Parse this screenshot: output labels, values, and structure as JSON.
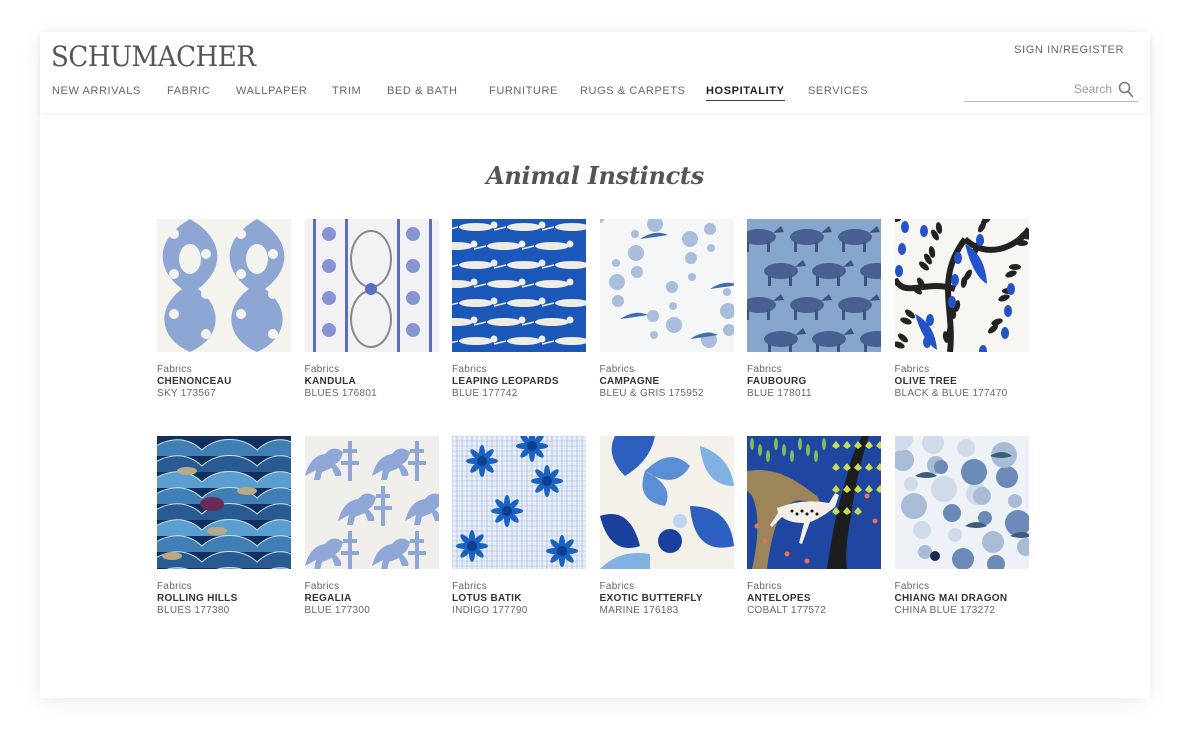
{
  "brand": {
    "logo": "SCHUMACHER"
  },
  "header": {
    "sign_in": "SIGN IN/REGISTER",
    "nav": [
      {
        "label": "NEW ARRIVALS",
        "active": false
      },
      {
        "label": "FABRIC",
        "active": false
      },
      {
        "label": "WALLPAPER",
        "active": false
      },
      {
        "label": "TRIM",
        "active": false
      },
      {
        "label": "BED & BATH",
        "active": false
      },
      {
        "label": "FURNITURE",
        "active": false
      },
      {
        "label": "RUGS & CARPETS",
        "active": false
      },
      {
        "label": "HOSPITALITY",
        "active": true
      },
      {
        "label": "SERVICES",
        "active": false
      }
    ],
    "search": {
      "placeholder": "Search",
      "value": "",
      "icon": "search-icon"
    }
  },
  "collection": {
    "title": "Animal Instincts",
    "products": [
      {
        "category": "Fabrics",
        "name": "CHENONCEAU",
        "colorway": "SKY 173567",
        "swatch": {
          "style": "damask",
          "bg": "#f5f3ee",
          "fg": "#8ea6d4"
        }
      },
      {
        "category": "Fabrics",
        "name": "KANDULA",
        "colorway": "BLUES 176801",
        "swatch": {
          "style": "stripe-toile",
          "bg": "#f2f2f4",
          "fg": "#5a6fc4"
        }
      },
      {
        "category": "Fabrics",
        "name": "LEAPING LEOPARDS",
        "colorway": "BLUE 177742",
        "swatch": {
          "style": "leopards",
          "bg": "#1a57b8",
          "fg": "#efece6"
        }
      },
      {
        "category": "Fabrics",
        "name": "CAMPAGNE",
        "colorway": "BLEU & GRIS 175952",
        "swatch": {
          "style": "floral-birds",
          "bg": "#f4f6f8",
          "fg": "#6b8fc2"
        }
      },
      {
        "category": "Fabrics",
        "name": "FAUBOURG",
        "colorway": "BLUE 178011",
        "swatch": {
          "style": "horses",
          "bg": "#87a6cc",
          "fg": "#3e5286"
        }
      },
      {
        "category": "Fabrics",
        "name": "OLIVE TREE",
        "colorway": "BLACK & BLUE 177470",
        "swatch": {
          "style": "olive-tree",
          "bg": "#f7f6f2",
          "fg": "#222222",
          "accent": "#2452c8"
        }
      },
      {
        "category": "Fabrics",
        "name": "ROLLING HILLS",
        "colorway": "BLUES 177380",
        "swatch": {
          "style": "waves",
          "bg": "#12305e",
          "fg": "#3f7fb5",
          "accent": "#b9a987"
        }
      },
      {
        "category": "Fabrics",
        "name": "REGALIA",
        "colorway": "BLUE 177300",
        "swatch": {
          "style": "lions",
          "bg": "#f0efeb",
          "fg": "#8ea7d6"
        }
      },
      {
        "category": "Fabrics",
        "name": "LOTUS BATIK",
        "colorway": "INDIGO 177790",
        "swatch": {
          "style": "batik",
          "bg": "#e9eef7",
          "fg": "#1b62c0"
        }
      },
      {
        "category": "Fabrics",
        "name": "EXOTIC BUTTERFLY",
        "colorway": "MARINE 176183",
        "swatch": {
          "style": "butterfly",
          "bg": "#f3f1ea",
          "fg": "#2d5fc0",
          "accent": "#7fb1e3"
        }
      },
      {
        "category": "Fabrics",
        "name": "ANTELOPES",
        "colorway": "COBALT 177572",
        "swatch": {
          "style": "antelopes",
          "bg": "#1f46a0",
          "fg": "#9c8559",
          "accent": "#c9dd52"
        }
      },
      {
        "category": "Fabrics",
        "name": "CHIANG MAI DRAGON",
        "colorway": "CHINA BLUE 173272",
        "swatch": {
          "style": "dragon",
          "bg": "#eef2f6",
          "fg": "#6c8ab8",
          "accent": "#3e5c7c"
        }
      }
    ]
  }
}
